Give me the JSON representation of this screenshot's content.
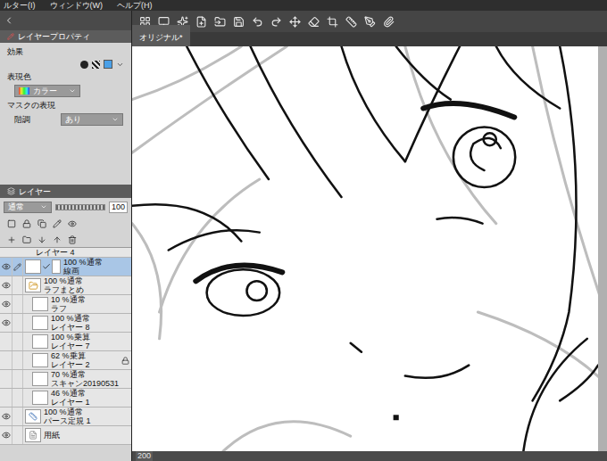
{
  "menu": [
    "ルター(I)",
    "ウィンドウ(W)",
    "ヘルプ(H)"
  ],
  "layer_property_panel": {
    "title": "レイヤープロパティ",
    "effect_label": "効果",
    "color_label": "表現色",
    "color_value": "カラー",
    "mask_label": "マスクの表現",
    "gradation_label": "階調",
    "gradation_value": "あり"
  },
  "layer_panel": {
    "title": "レイヤー",
    "blend_mode": "通常",
    "opacity": "100",
    "opacity_level": 1.0,
    "cut_off_layer": "レイヤー 4",
    "layers": [
      {
        "mode": "100 %通常",
        "name": "線画",
        "kind": "raster",
        "selected": true,
        "visible": true,
        "locked": false,
        "in_folder": false
      },
      {
        "mode": "100 %通常",
        "name": "ラフまとめ",
        "kind": "folder",
        "selected": false,
        "visible": true,
        "locked": false,
        "in_folder": false
      },
      {
        "mode": "10 %通常",
        "name": "ラフ",
        "kind": "raster",
        "selected": false,
        "visible": true,
        "locked": false,
        "in_folder": true
      },
      {
        "mode": "100 %通常",
        "name": "レイヤー 8",
        "kind": "raster",
        "selected": false,
        "visible": true,
        "locked": false,
        "in_folder": true
      },
      {
        "mode": "100 %乗算",
        "name": "レイヤー 7",
        "kind": "raster",
        "selected": false,
        "visible": false,
        "locked": false,
        "in_folder": true
      },
      {
        "mode": "62 %乗算",
        "name": "レイヤー 2",
        "kind": "raster",
        "selected": false,
        "visible": false,
        "locked": true,
        "in_folder": true
      },
      {
        "mode": "70 %通常",
        "name": "スキャン20190531",
        "kind": "raster",
        "selected": false,
        "visible": false,
        "locked": false,
        "in_folder": true
      },
      {
        "mode": "46 %通常",
        "name": "レイヤー 1",
        "kind": "raster",
        "selected": false,
        "visible": false,
        "locked": false,
        "in_folder": true
      },
      {
        "mode": "100 %通常",
        "name": "パース定規 1",
        "kind": "ruler",
        "selected": false,
        "visible": true,
        "locked": false,
        "in_folder": false
      },
      {
        "mode": "",
        "name": "用紙",
        "kind": "paper",
        "selected": false,
        "visible": true,
        "locked": false,
        "in_folder": false
      }
    ]
  },
  "canvas": {
    "tab": "オリジナル*",
    "zoom": "200"
  }
}
